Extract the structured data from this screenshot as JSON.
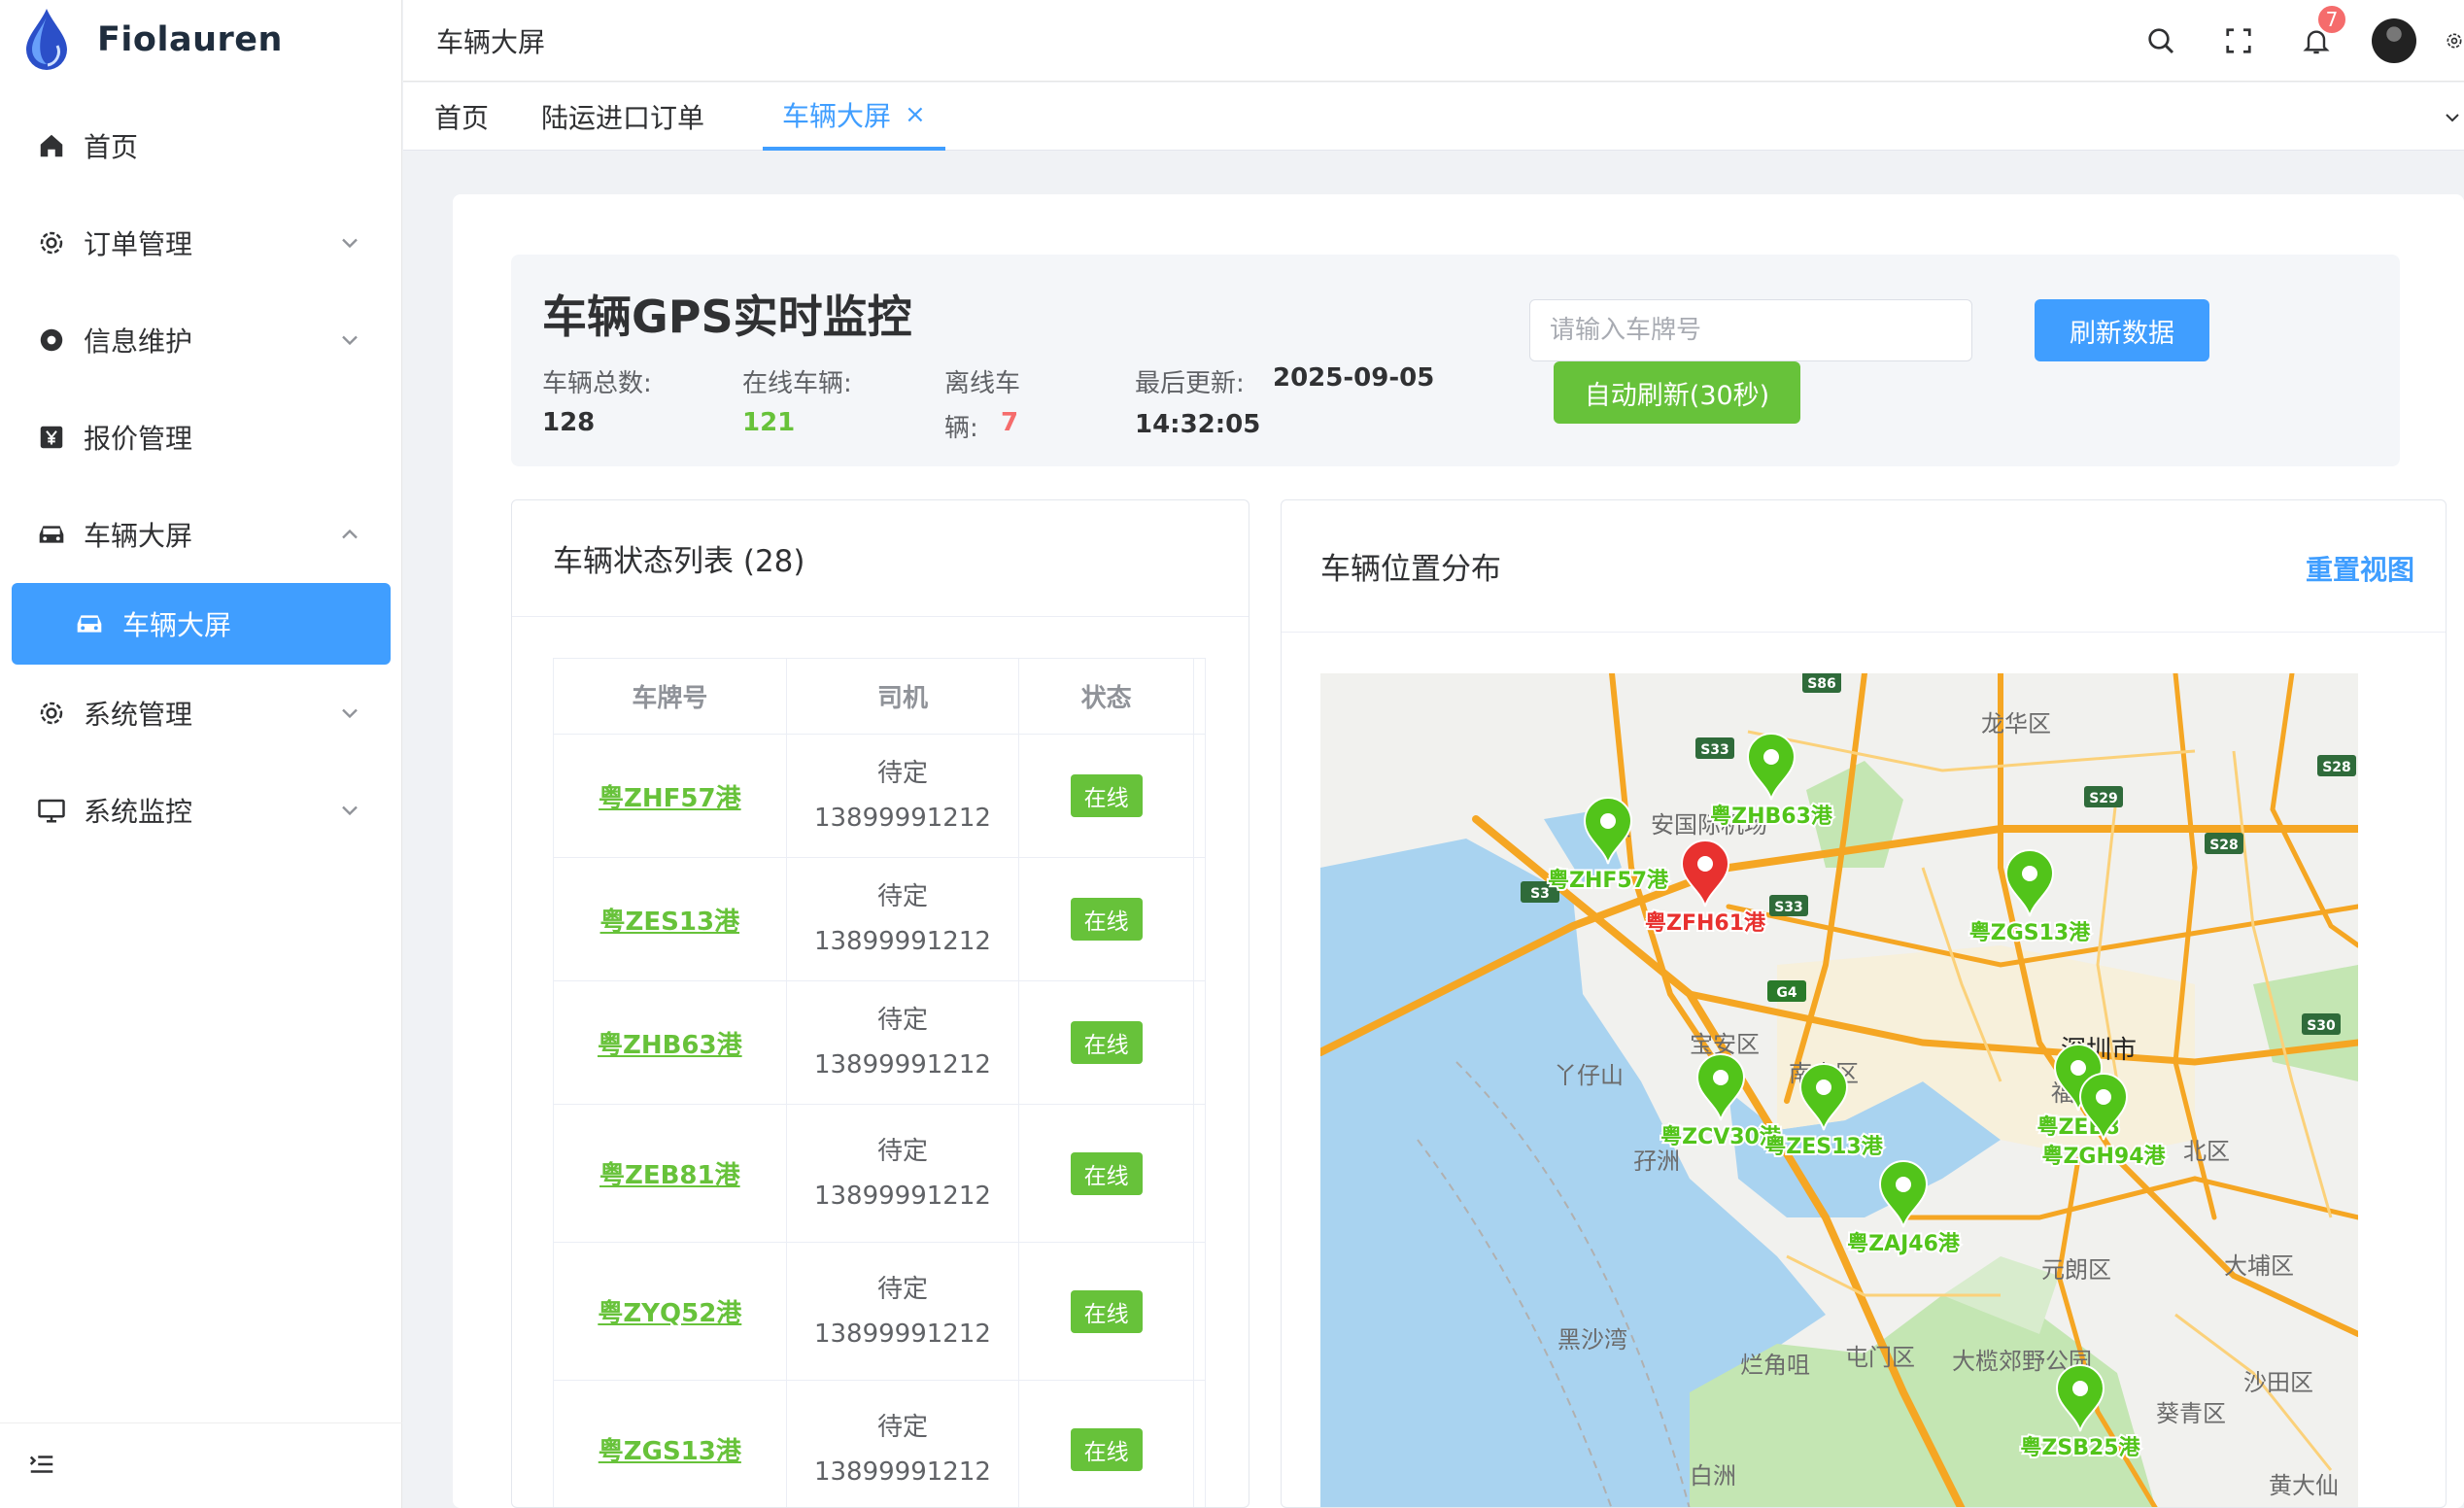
{
  "app": {
    "name": "Fiolauren"
  },
  "sidebar": {
    "items": [
      {
        "label": "首页",
        "icon": "home-icon"
      },
      {
        "label": "订单管理",
        "icon": "gear-icon"
      },
      {
        "label": "信息维护",
        "icon": "gear-solid-icon"
      },
      {
        "label": "报价管理",
        "icon": "yen-icon"
      },
      {
        "label": "车辆大屏",
        "icon": "car-icon"
      },
      {
        "label": "系统管理",
        "icon": "gear-icon"
      },
      {
        "label": "系统监控",
        "icon": "monitor-icon"
      }
    ],
    "active_sub": {
      "label": "车辆大屏",
      "icon": "car-icon"
    }
  },
  "header": {
    "breadcrumb": "车辆大屏",
    "notification_count": "7"
  },
  "tabs": [
    {
      "label": "首页"
    },
    {
      "label": "陆运进口订单"
    },
    {
      "label": "车辆大屏",
      "active": true,
      "close": "×"
    }
  ],
  "summary": {
    "title": "车辆GPS实时监控",
    "total_label": "车辆总数:",
    "total_value": "128",
    "online_label": "在线车辆:",
    "online_value": "121",
    "offline_label_1": "离线车",
    "offline_label_2": "辆:",
    "offline_value": "7",
    "updated_label": "最后更新:",
    "updated_date": "2025-09-05",
    "updated_time": "14:32:05",
    "search_placeholder": "请输入车牌号",
    "refresh_button": "刷新数据",
    "auto_refresh_button": "自动刷新(30秒)"
  },
  "list": {
    "title": "车辆状态列表 (28)",
    "columns": [
      "车牌号",
      "司机",
      "状态"
    ],
    "rows": [
      {
        "plate": "粤ZHF57港",
        "driver": "待定",
        "phone": "13899991212",
        "status": "在线"
      },
      {
        "plate": "粤ZES13港",
        "driver": "待定",
        "phone": "13899991212",
        "status": "在线"
      },
      {
        "plate": "粤ZHB63港",
        "driver": "待定",
        "phone": "13899991212",
        "status": "在线"
      },
      {
        "plate": "粤ZEB81港",
        "driver": "待定",
        "phone": "13899991212",
        "status": "在线"
      },
      {
        "plate": "粤ZYQ52港",
        "driver": "待定",
        "phone": "13899991212",
        "status": "在线"
      },
      {
        "plate": "粤ZGS13港",
        "driver": "待定",
        "phone": "13899991212",
        "status": "在线"
      }
    ]
  },
  "map": {
    "title": "车辆位置分布",
    "reset_label": "重置视图",
    "place_labels": [
      "龙华区",
      "深圳市",
      "宝安区",
      "南山区",
      "福田区",
      "丫仔山",
      "孖洲",
      "元朗区",
      "大埔区",
      "黑沙湾",
      "烂角咀",
      "屯门区",
      "大榄郊野公园",
      "沙田区",
      "葵青区",
      "白洲",
      "黄大仙",
      "北区",
      "深",
      "安国际机场"
    ],
    "road_labels": [
      "S86",
      "S33",
      "S29",
      "S28",
      "S28",
      "S3",
      "S33",
      "G4",
      "S30"
    ],
    "markers": [
      {
        "label": "粤ZFH61港",
        "color": "#e8312f"
      },
      {
        "label": "粤ZHB63港",
        "color": "#52c41a"
      },
      {
        "label": "粤ZGS13港",
        "color": "#52c41a"
      },
      {
        "label": "粤ZCV30港",
        "color": "#52c41a"
      },
      {
        "label": "粤ZES13港",
        "color": "#52c41a"
      },
      {
        "label": "粤ZEB8",
        "color": "#52c41a"
      },
      {
        "label": "粤ZGH94港",
        "color": "#52c41a"
      },
      {
        "label": "粤ZAJ46港",
        "color": "#52c41a"
      },
      {
        "label": "粤ZSB25港",
        "color": "#52c41a"
      },
      {
        "label": "粤ZHF57港",
        "color": "#52c41a"
      }
    ]
  },
  "colors": {
    "primary": "#409eff",
    "success": "#67c23a",
    "danger": "#f56c6c"
  }
}
